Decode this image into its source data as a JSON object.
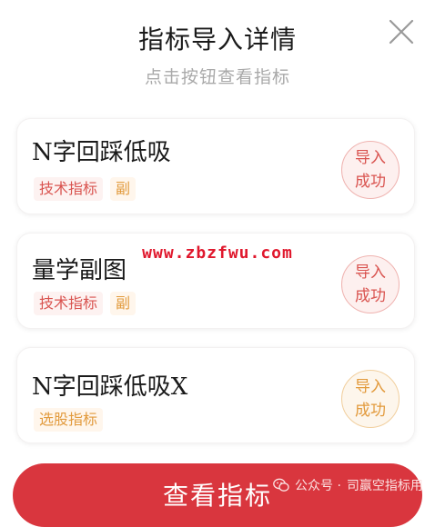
{
  "dialog": {
    "title": "指标导入详情",
    "subtitle": "点击按钮查看指标"
  },
  "indicators": [
    {
      "name": "N字回踩低吸",
      "tags": [
        "技术指标",
        "副"
      ],
      "status": [
        "导入",
        "成功"
      ]
    },
    {
      "name": "量学副图",
      "tags": [
        "技术指标",
        "副"
      ],
      "status": [
        "导入",
        "成功"
      ]
    },
    {
      "name": "N字回踩低吸X",
      "tags": [
        "选股指标"
      ],
      "status": [
        "导入",
        "成功"
      ]
    }
  ],
  "watermark": "www.zbzfwu.com",
  "footer": {
    "view_label": "查看指标",
    "source_prefix": "公众号 · ",
    "source_name": "司赢空指标用"
  },
  "colors": {
    "accent_red": "#d9363e",
    "tag_red": "#d9534f",
    "tag_orange": "#e29a3c",
    "watermark": "#e0182d"
  },
  "icons": {
    "close": "close-icon",
    "wechat": "wechat-icon"
  }
}
